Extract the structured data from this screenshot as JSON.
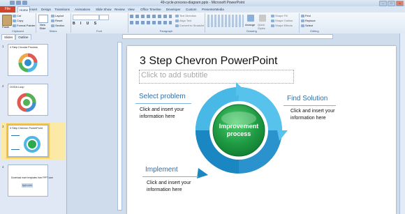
{
  "window": {
    "title": "49-cycle-process-diagram.pptx - Microsoft PowerPoint"
  },
  "tabs": [
    "File",
    "Home",
    "Insert",
    "Design",
    "Transitions",
    "Animations",
    "Slide Show",
    "Review",
    "View",
    "Office Timeline",
    "Developer",
    "Custom",
    "PresenterMedia"
  ],
  "ribbon": {
    "clipboard": {
      "paste": "Paste",
      "cut": "Cut",
      "copy": "Copy",
      "format_painter": "Format Painter",
      "label": "Clipboard"
    },
    "slides": {
      "new_slide": "New Slide",
      "layout": "Layout",
      "reset": "Reset",
      "section": "Section",
      "label": "Slides"
    },
    "font": {
      "label": "Font"
    },
    "paragraph": {
      "text_direction": "Text Direction",
      "align_text": "Align Text",
      "smartart": "Convert to SmartArt",
      "label": "Paragraph"
    },
    "drawing": {
      "arrange": "Arrange",
      "quick_styles": "Quick Styles",
      "shape_fill": "Shape Fill",
      "shape_outline": "Shape Outline",
      "shape_effects": "Shape Effects",
      "label": "Drawing"
    },
    "editing": {
      "find": "Find",
      "replace": "Replace",
      "select": "Select",
      "label": "Editing"
    }
  },
  "panel": {
    "tabs": [
      "Slides",
      "Outline"
    ],
    "thumbnails": [
      {
        "num": "1",
        "title": "4 Step Circular Process"
      },
      {
        "num": "2",
        "title": "OODA Loop"
      },
      {
        "num": "3",
        "title": "3 Step Chevron PowerPoint"
      },
      {
        "num": "4",
        "title": "Download more templates from FPPT.com",
        "logo": "fppt.com"
      }
    ]
  },
  "slide": {
    "title": "3 Step Chevron PowerPoint",
    "subtitle_placeholder": "Click to add subtitle",
    "center_label": "Improvement process",
    "sections": [
      {
        "heading": "Select problem",
        "body": "Click and insert your information here"
      },
      {
        "heading": "Find Solution",
        "body": "Click and insert your information here"
      },
      {
        "heading": "Implement",
        "body": "Click and insert your information here"
      }
    ]
  },
  "colors": {
    "file_tab": "#d0442b",
    "heading_blue": "#2f6fa5",
    "ring_light": "#57c3ec",
    "ring_dark": "#1a86c2",
    "center_green": "#2daa4f",
    "selection": "#f6c344"
  }
}
